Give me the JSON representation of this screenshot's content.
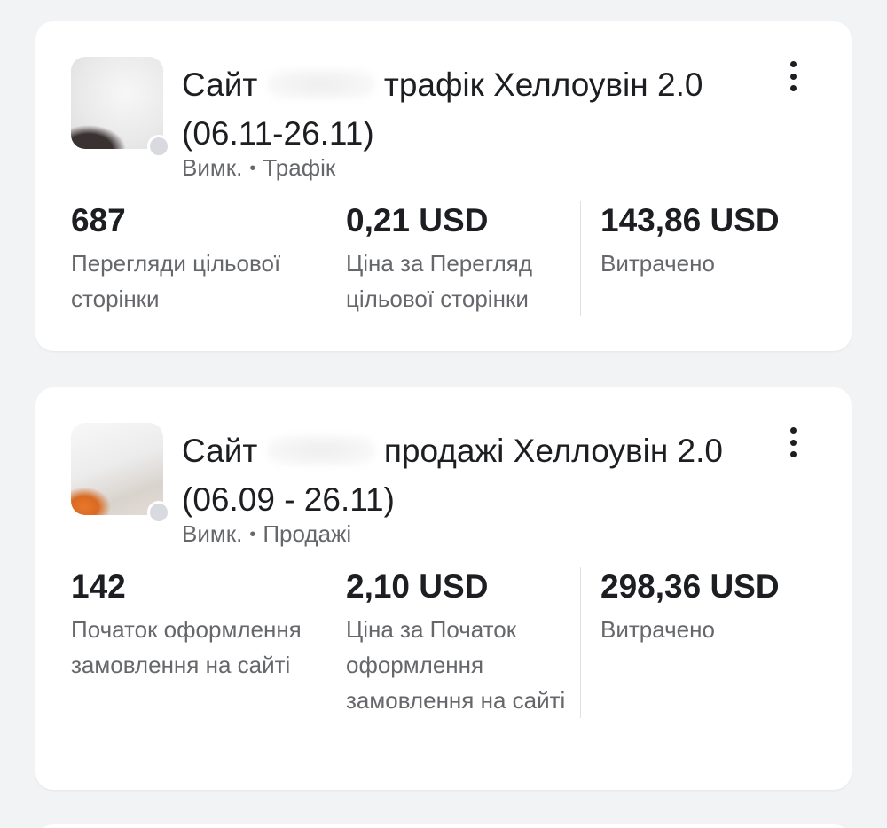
{
  "campaigns": [
    {
      "title_prefix": "Сайт",
      "title_suffix": "трафік Хеллоувін 2.0 (06.11-26.11)",
      "status": "Вимк.",
      "separator": "•",
      "objective": "Трафік",
      "thumbnail_icon": "ad-thumbnail",
      "status_indicator_color": "#d8dadf",
      "metrics": [
        {
          "value": "687",
          "label": "Перегляди цільової сторінки"
        },
        {
          "value": "0,21 USD",
          "label": "Ціна за Перегляд цільової сторінки"
        },
        {
          "value": "143,86 USD",
          "label": "Витрачено"
        }
      ]
    },
    {
      "title_prefix": "Сайт",
      "title_suffix": "продажі Хеллоувін 2.0 (06.09 - 26.11)",
      "status": "Вимк.",
      "separator": "•",
      "objective": "Продажі",
      "thumbnail_icon": "ad-thumbnail",
      "status_indicator_color": "#d8dadf",
      "metrics": [
        {
          "value": "142",
          "label": "Початок оформлення замовлення на сайті"
        },
        {
          "value": "2,10 USD",
          "label": "Ціна за Початок оформлення замовлення на сайті"
        },
        {
          "value": "298,36 USD",
          "label": "Витрачено"
        }
      ]
    }
  ],
  "colors": {
    "background": "#f2f3f5",
    "card": "#ffffff",
    "primary_text": "#1c1e21",
    "secondary_text": "#65676b",
    "divider": "#dfe1e5"
  }
}
